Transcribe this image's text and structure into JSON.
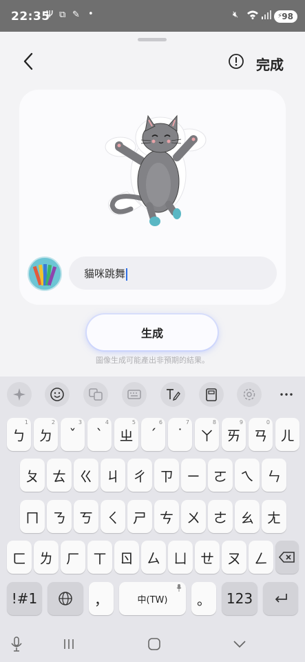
{
  "status_bar": {
    "time": "22:35",
    "battery": "98"
  },
  "header": {
    "done_label": "完成"
  },
  "prompt": {
    "value": "貓咪跳舞"
  },
  "generate": {
    "label": "生成",
    "disclaimer": "圖像生成可能產出非預期的結果。"
  },
  "keyboard": {
    "row1": [
      {
        "key": "ㄅ",
        "hint": "1"
      },
      {
        "key": "ㄉ",
        "hint": "2"
      },
      {
        "key": "ˇ",
        "hint": "3"
      },
      {
        "key": "ˋ",
        "hint": "4"
      },
      {
        "key": "ㄓ",
        "hint": "5"
      },
      {
        "key": "ˊ",
        "hint": "6"
      },
      {
        "key": "˙",
        "hint": "7"
      },
      {
        "key": "ㄚ",
        "hint": "8"
      },
      {
        "key": "ㄞ",
        "hint": "9"
      },
      {
        "key": "ㄢ",
        "hint": "0"
      },
      {
        "key": "ㄦ",
        "hint": ""
      }
    ],
    "row2": [
      "ㄆ",
      "ㄊ",
      "ㄍ",
      "ㄐ",
      "ㄔ",
      "ㄗ",
      "ㄧ",
      "ㄛ",
      "ㄟ",
      "ㄣ"
    ],
    "row3": [
      "ㄇ",
      "ㄋ",
      "ㄎ",
      "ㄑ",
      "ㄕ",
      "ㄘ",
      "ㄨ",
      "ㄜ",
      "ㄠ",
      "ㄤ"
    ],
    "row4": [
      "ㄈ",
      "ㄌ",
      "ㄏ",
      "ㄒ",
      "ㄖ",
      "ㄙ",
      "ㄩ",
      "ㄝ",
      "ㄡ",
      "ㄥ"
    ],
    "symbols_label": "!#1",
    "comma": "，",
    "space_label": "中(TW)",
    "period": "。",
    "numbers_label": "123"
  },
  "icons": {
    "back": "back-chevron-icon",
    "info": "info-icon",
    "toolbar": [
      "sparkle-icon",
      "emoji-icon",
      "translate-icon",
      "keyboard-icon",
      "handwriting-icon",
      "clipboard-icon",
      "settings-icon",
      "more-icon"
    ]
  }
}
